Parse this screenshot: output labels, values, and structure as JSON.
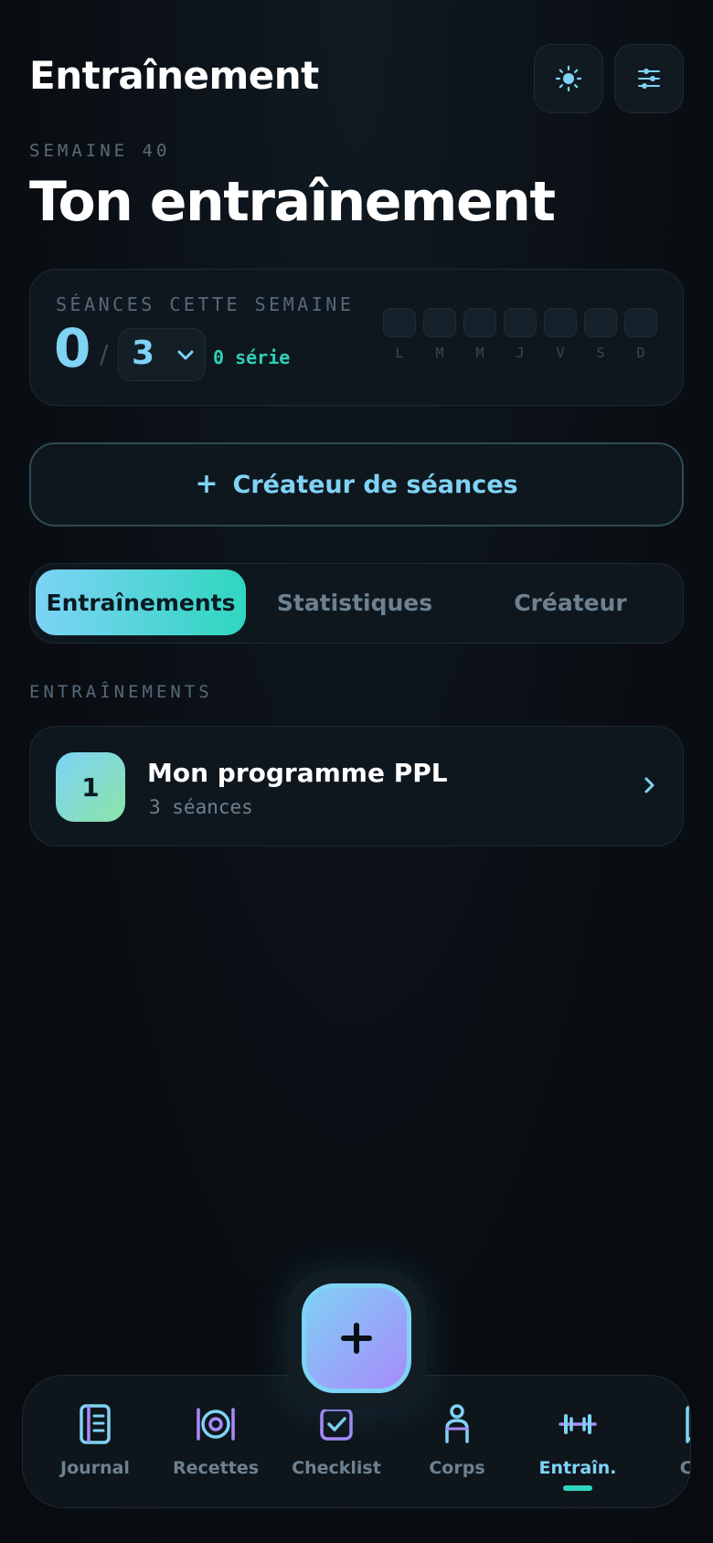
{
  "header": {
    "title": "Entraînement",
    "buttons": [
      {
        "icon": "sun-icon"
      },
      {
        "icon": "sliders-icon"
      }
    ]
  },
  "week": {
    "label": "SEMAINE 40",
    "title": "Ton entraînement"
  },
  "sessions": {
    "label": "SÉANCES CETTE SEMAINE",
    "done": "0",
    "separator": "/",
    "goal": "3",
    "streak": "0 série",
    "days": [
      "L",
      "M",
      "M",
      "J",
      "V",
      "S",
      "D"
    ]
  },
  "creator_button": {
    "plus": "+",
    "label": "Créateur de séances"
  },
  "tabs": [
    {
      "label": "Entraînements",
      "active": true
    },
    {
      "label": "Statistiques",
      "active": false
    },
    {
      "label": "Créateur",
      "active": false
    }
  ],
  "section": {
    "label": "ENTRAÎNEMENTS"
  },
  "programs": [
    {
      "badge": "1",
      "name": "Mon programme PPL",
      "subtitle": "3 séances"
    }
  ],
  "fab": {
    "icon": "plus-icon"
  },
  "bottom_nav": [
    {
      "label": "Journal",
      "icon": "notebook-icon"
    },
    {
      "label": "Recettes",
      "icon": "plate-icon"
    },
    {
      "label": "Checklist",
      "icon": "checkbox-icon"
    },
    {
      "label": "Corps",
      "icon": "person-icon"
    },
    {
      "label": "Entraîn.",
      "icon": "dumbbell-icon",
      "active": true
    },
    {
      "label": "Con",
      "icon": "book-icon"
    }
  ],
  "colors": {
    "accent": "#7fd3f5",
    "accent_teal": "#2fd6bf",
    "accent_violet": "#a78bfa",
    "background": "#0a0f14"
  }
}
